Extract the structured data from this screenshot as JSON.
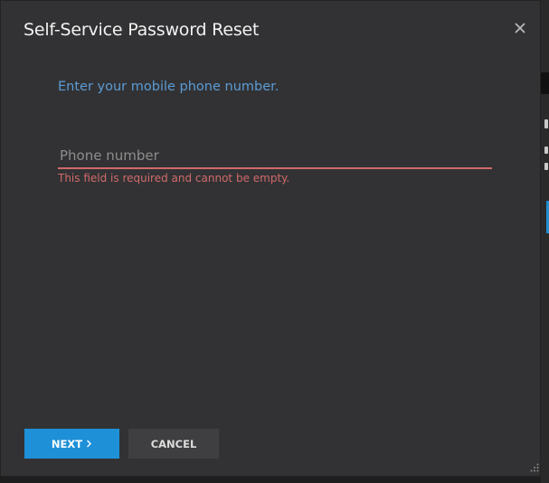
{
  "dialog": {
    "title": "Self-Service Password Reset",
    "close_icon": "close-icon",
    "instruction": "Enter your mobile phone number.",
    "phone_field": {
      "value": "",
      "placeholder": "Phone number"
    },
    "error_message": "This field is required and cannot be empty.",
    "buttons": {
      "next_label": "NEXT",
      "next_icon": "chevron-right-icon",
      "cancel_label": "CANCEL"
    }
  },
  "colors": {
    "dialog_background": "#323234",
    "accent": "#1e90d8",
    "instruction_text": "#5b9bd5",
    "error": "#d06a6a"
  }
}
